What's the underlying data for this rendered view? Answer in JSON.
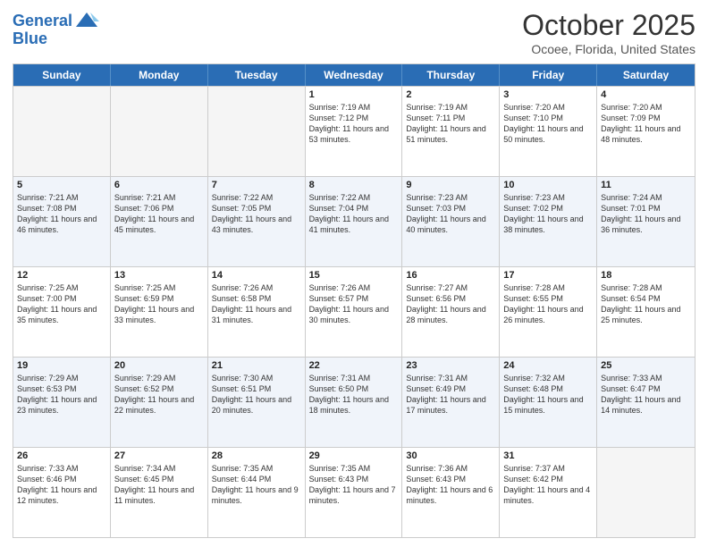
{
  "header": {
    "logo_line1": "General",
    "logo_line2": "Blue",
    "month": "October 2025",
    "location": "Ocoee, Florida, United States"
  },
  "days_of_week": [
    "Sunday",
    "Monday",
    "Tuesday",
    "Wednesday",
    "Thursday",
    "Friday",
    "Saturday"
  ],
  "weeks": [
    [
      {
        "day": "",
        "info": ""
      },
      {
        "day": "",
        "info": ""
      },
      {
        "day": "",
        "info": ""
      },
      {
        "day": "1",
        "info": "Sunrise: 7:19 AM\nSunset: 7:12 PM\nDaylight: 11 hours and 53 minutes."
      },
      {
        "day": "2",
        "info": "Sunrise: 7:19 AM\nSunset: 7:11 PM\nDaylight: 11 hours and 51 minutes."
      },
      {
        "day": "3",
        "info": "Sunrise: 7:20 AM\nSunset: 7:10 PM\nDaylight: 11 hours and 50 minutes."
      },
      {
        "day": "4",
        "info": "Sunrise: 7:20 AM\nSunset: 7:09 PM\nDaylight: 11 hours and 48 minutes."
      }
    ],
    [
      {
        "day": "5",
        "info": "Sunrise: 7:21 AM\nSunset: 7:08 PM\nDaylight: 11 hours and 46 minutes."
      },
      {
        "day": "6",
        "info": "Sunrise: 7:21 AM\nSunset: 7:06 PM\nDaylight: 11 hours and 45 minutes."
      },
      {
        "day": "7",
        "info": "Sunrise: 7:22 AM\nSunset: 7:05 PM\nDaylight: 11 hours and 43 minutes."
      },
      {
        "day": "8",
        "info": "Sunrise: 7:22 AM\nSunset: 7:04 PM\nDaylight: 11 hours and 41 minutes."
      },
      {
        "day": "9",
        "info": "Sunrise: 7:23 AM\nSunset: 7:03 PM\nDaylight: 11 hours and 40 minutes."
      },
      {
        "day": "10",
        "info": "Sunrise: 7:23 AM\nSunset: 7:02 PM\nDaylight: 11 hours and 38 minutes."
      },
      {
        "day": "11",
        "info": "Sunrise: 7:24 AM\nSunset: 7:01 PM\nDaylight: 11 hours and 36 minutes."
      }
    ],
    [
      {
        "day": "12",
        "info": "Sunrise: 7:25 AM\nSunset: 7:00 PM\nDaylight: 11 hours and 35 minutes."
      },
      {
        "day": "13",
        "info": "Sunrise: 7:25 AM\nSunset: 6:59 PM\nDaylight: 11 hours and 33 minutes."
      },
      {
        "day": "14",
        "info": "Sunrise: 7:26 AM\nSunset: 6:58 PM\nDaylight: 11 hours and 31 minutes."
      },
      {
        "day": "15",
        "info": "Sunrise: 7:26 AM\nSunset: 6:57 PM\nDaylight: 11 hours and 30 minutes."
      },
      {
        "day": "16",
        "info": "Sunrise: 7:27 AM\nSunset: 6:56 PM\nDaylight: 11 hours and 28 minutes."
      },
      {
        "day": "17",
        "info": "Sunrise: 7:28 AM\nSunset: 6:55 PM\nDaylight: 11 hours and 26 minutes."
      },
      {
        "day": "18",
        "info": "Sunrise: 7:28 AM\nSunset: 6:54 PM\nDaylight: 11 hours and 25 minutes."
      }
    ],
    [
      {
        "day": "19",
        "info": "Sunrise: 7:29 AM\nSunset: 6:53 PM\nDaylight: 11 hours and 23 minutes."
      },
      {
        "day": "20",
        "info": "Sunrise: 7:29 AM\nSunset: 6:52 PM\nDaylight: 11 hours and 22 minutes."
      },
      {
        "day": "21",
        "info": "Sunrise: 7:30 AM\nSunset: 6:51 PM\nDaylight: 11 hours and 20 minutes."
      },
      {
        "day": "22",
        "info": "Sunrise: 7:31 AM\nSunset: 6:50 PM\nDaylight: 11 hours and 18 minutes."
      },
      {
        "day": "23",
        "info": "Sunrise: 7:31 AM\nSunset: 6:49 PM\nDaylight: 11 hours and 17 minutes."
      },
      {
        "day": "24",
        "info": "Sunrise: 7:32 AM\nSunset: 6:48 PM\nDaylight: 11 hours and 15 minutes."
      },
      {
        "day": "25",
        "info": "Sunrise: 7:33 AM\nSunset: 6:47 PM\nDaylight: 11 hours and 14 minutes."
      }
    ],
    [
      {
        "day": "26",
        "info": "Sunrise: 7:33 AM\nSunset: 6:46 PM\nDaylight: 11 hours and 12 minutes."
      },
      {
        "day": "27",
        "info": "Sunrise: 7:34 AM\nSunset: 6:45 PM\nDaylight: 11 hours and 11 minutes."
      },
      {
        "day": "28",
        "info": "Sunrise: 7:35 AM\nSunset: 6:44 PM\nDaylight: 11 hours and 9 minutes."
      },
      {
        "day": "29",
        "info": "Sunrise: 7:35 AM\nSunset: 6:43 PM\nDaylight: 11 hours and 7 minutes."
      },
      {
        "day": "30",
        "info": "Sunrise: 7:36 AM\nSunset: 6:43 PM\nDaylight: 11 hours and 6 minutes."
      },
      {
        "day": "31",
        "info": "Sunrise: 7:37 AM\nSunset: 6:42 PM\nDaylight: 11 hours and 4 minutes."
      },
      {
        "day": "",
        "info": ""
      }
    ]
  ]
}
